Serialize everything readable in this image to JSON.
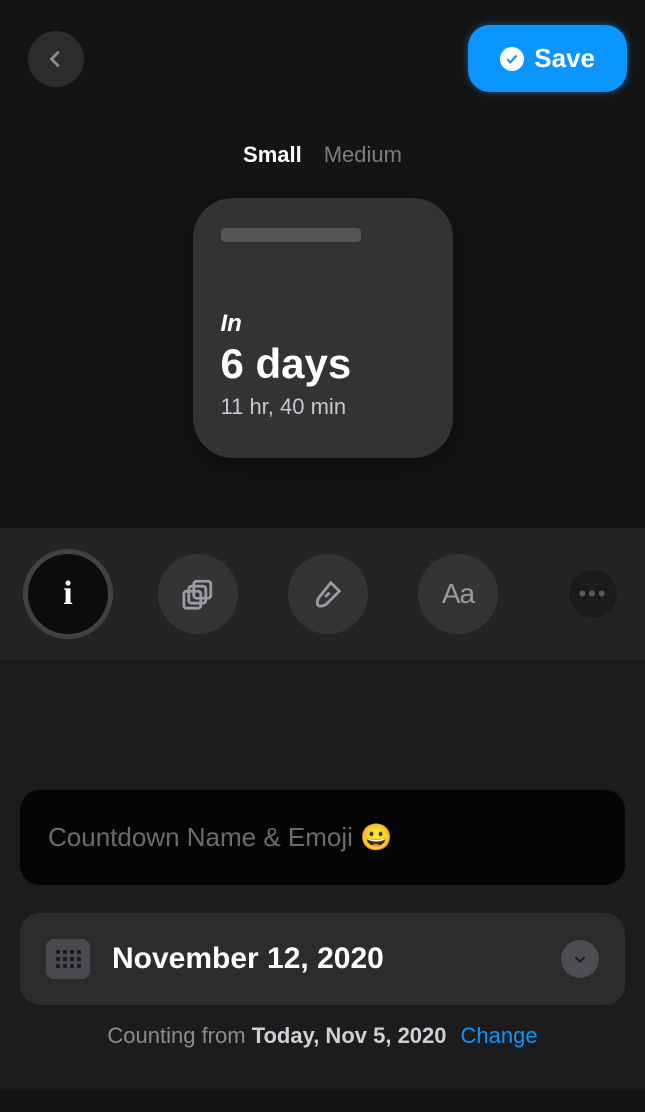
{
  "header": {
    "save_label": "Save"
  },
  "size_tabs": {
    "small": "Small",
    "medium": "Medium",
    "selected": "small"
  },
  "widget": {
    "prefix": "In",
    "main": "6 days",
    "sub": "11 hr, 40 min"
  },
  "tools": {
    "selected": "info",
    "font_glyph": "Aa"
  },
  "name_input": {
    "placeholder": "Countdown Name & Emoji 😀",
    "value": ""
  },
  "date": {
    "display": "November 12, 2020"
  },
  "counting_from": {
    "prefix": "Counting from ",
    "bold": "Today, Nov 5, 2020",
    "change_label": "Change"
  }
}
